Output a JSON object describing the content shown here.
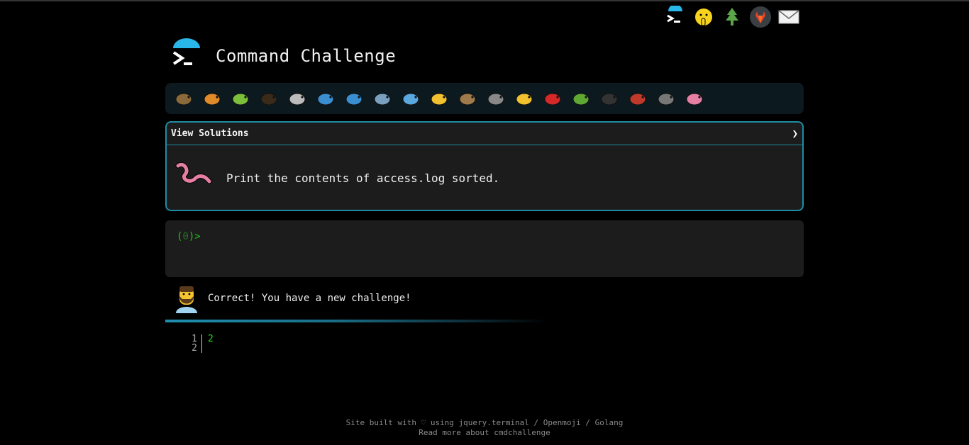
{
  "top_icons": [
    {
      "name": "terminal-icon"
    },
    {
      "name": "shushing-face-icon"
    },
    {
      "name": "evergreen-tree-icon"
    },
    {
      "name": "gitlab-icon"
    },
    {
      "name": "envelope-icon"
    }
  ],
  "header": {
    "title": "Command Challenge"
  },
  "animals": [
    "snail-icon",
    "butterfly-icon",
    "caterpillar-icon",
    "ant-icon",
    "spider-web-icon",
    "whale-icon",
    "spouting-whale-icon",
    "dolphin-icon",
    "fish-icon",
    "tropical-fish-icon",
    "blowfish-icon",
    "wolf-icon",
    "bee-icon",
    "ladybug-icon",
    "cricket-icon",
    "spider-icon",
    "scorpion-icon",
    "fly-icon",
    "worm-icon"
  ],
  "challenge": {
    "view_solutions": "View Solutions",
    "chevron": "❯",
    "text": "Print the contents of access.log sorted."
  },
  "terminal": {
    "prompt_open": "(",
    "prompt_num": "0",
    "prompt_close": ")>"
  },
  "feedback": {
    "text": "Correct! You have a new challenge!"
  },
  "progress": {
    "fraction": 0.6
  },
  "output": {
    "line_numbers": [
      "1",
      "2"
    ],
    "lines": [
      "2",
      ""
    ]
  },
  "footer": {
    "line1_prefix": "Site built with ♡ using ",
    "link_jquery": "jquery.terminal",
    "sep1": " / ",
    "link_openmoji": "Openmoji",
    "sep2": " / ",
    "link_golang": "Golang",
    "line2": "Read more about cmdchallenge"
  }
}
